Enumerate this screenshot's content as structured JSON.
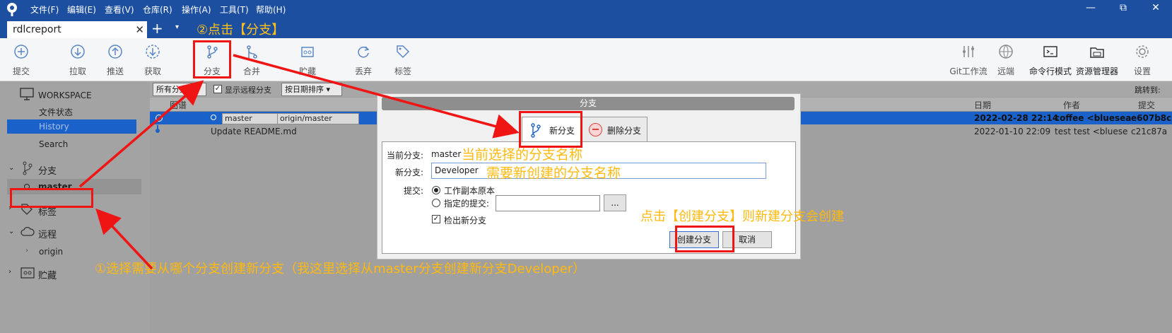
{
  "menu": [
    "文件(F)",
    "编辑(E)",
    "查看(V)",
    "仓库(R)",
    "操作(A)",
    "工具(T)",
    "帮助(H)"
  ],
  "window_controls": {
    "minimize": "—",
    "restore": "⧉",
    "close": "✕"
  },
  "tab": {
    "title": "rdlcreport",
    "close": "✕",
    "add": "+",
    "more": "▾"
  },
  "toolbar_left": [
    {
      "label": "提交",
      "icon": "commit-icon"
    },
    {
      "label": "拉取",
      "icon": "pull-icon"
    },
    {
      "label": "推送",
      "icon": "push-icon"
    },
    {
      "label": "获取",
      "icon": "fetch-icon"
    },
    {
      "label": "分支",
      "icon": "branch-icon"
    },
    {
      "label": "合并",
      "icon": "merge-icon"
    },
    {
      "label": "贮藏",
      "icon": "stash-icon"
    },
    {
      "label": "丢弃",
      "icon": "discard-icon"
    },
    {
      "label": "标签",
      "icon": "tag-icon"
    }
  ],
  "toolbar_right": [
    {
      "label": "Git工作流",
      "icon": "git-flow-icon"
    },
    {
      "label": "远端",
      "icon": "remote-globe-icon"
    },
    {
      "label": "命令行模式",
      "icon": "terminal-icon"
    },
    {
      "label": "资源管理器",
      "icon": "explorer-icon"
    },
    {
      "label": "设置",
      "icon": "gear-icon"
    }
  ],
  "sidebar": {
    "workspace": "WORKSPACE",
    "items": [
      "文件状态",
      "History",
      "Search"
    ],
    "branches_header": "分支",
    "branch_current": "master",
    "tags_header": "标签",
    "remotes_header": "远程",
    "remote_origin": "origin",
    "stashes_header": "贮藏"
  },
  "filters": {
    "branches": "所有分支 ▾",
    "show_remote": "显示远程分支",
    "sort": "按日期排序 ▾",
    "jump_to": "跳转到:"
  },
  "columns": {
    "graph": "图谱",
    "date": "日期",
    "author": "作者",
    "commit": "提交"
  },
  "commits": [
    {
      "refs": [
        "master",
        "origin/master"
      ],
      "date": "2022-02-28 22:14",
      "author": "coffee <bluesea",
      "hash": "e607b8c"
    },
    {
      "message": "Update README.md",
      "date": "2022-01-10 22:09",
      "author": "test test <bluese",
      "hash": "c21c87a"
    }
  ],
  "dialog": {
    "title": "分支",
    "tab_new": "新分支",
    "tab_delete": "删除分支",
    "current_branch_label": "当前分支:",
    "current_branch_value": "master",
    "new_branch_label": "新分支:",
    "new_branch_value": "Developer",
    "commit_label": "提交:",
    "option_working_copy": "工作副本原本",
    "option_specified": "指定的提交:",
    "browse": "...",
    "checkout_label": "检出新分支",
    "checkout_mark": "✓",
    "create_button": "创建分支",
    "cancel_button": "取消"
  },
  "annotations": {
    "step2": "②点击【分支】",
    "current_note": "当前选择的分支名称",
    "new_note": "需要新创建的分支名称",
    "create_note": "点击【创建分支】则新建分支会创建",
    "step1": "①选择需要从哪个分支创建新分支（我这里选择从master分支创建新分支Developer）"
  },
  "colors": {
    "titlebar": "#1d4fa0",
    "selected_row": "#1a61c9",
    "annotation": "#ffb90f",
    "highlight": "#f01515"
  }
}
